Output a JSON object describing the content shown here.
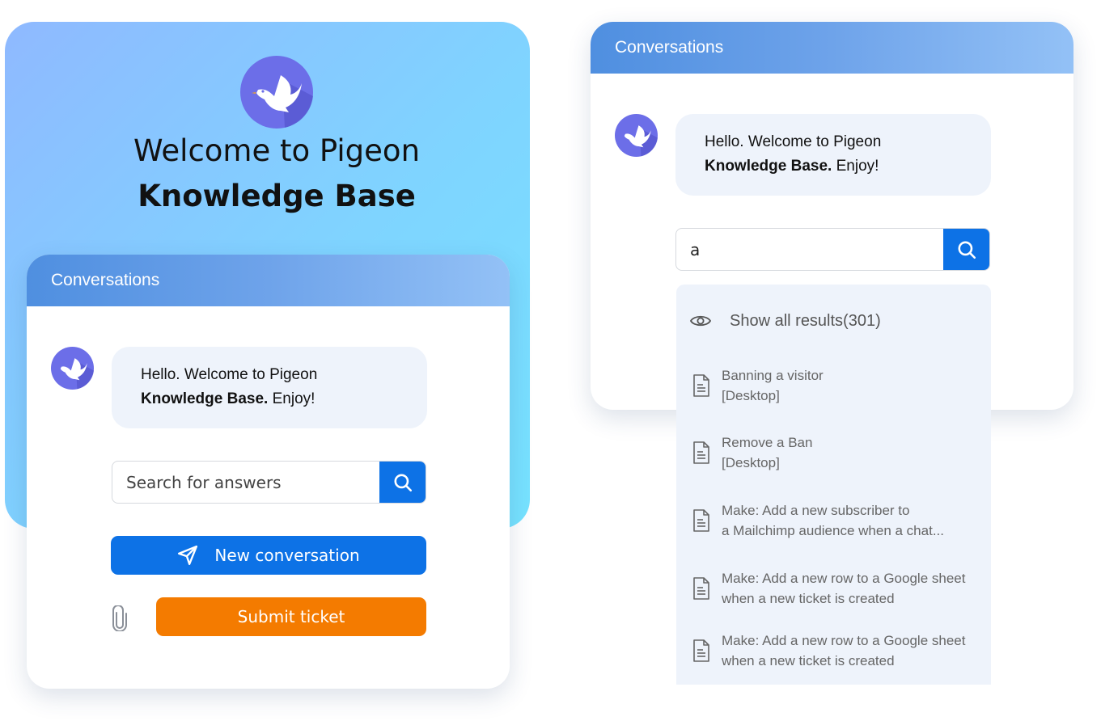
{
  "hero": {
    "title_line1": "Welcome to Pigeon",
    "title_line2": "Knowledge Base",
    "logo_icon": "pigeon-logo-icon"
  },
  "colors": {
    "accent_blue": "#0d72e6",
    "ticket_orange": "#f47b00",
    "avatar_purple": "#6c6ee8",
    "bubble_bg": "#eef3fb"
  },
  "left_widget": {
    "header_title": "Conversations",
    "message": {
      "line1": "Hello. Welcome to Pigeon",
      "bold": "Knowledge Base.",
      "rest": " Enjoy!"
    },
    "search": {
      "placeholder": "Search for answers",
      "value": ""
    },
    "new_conversation_label": "New conversation",
    "submit_ticket_label": "Submit ticket",
    "icons": [
      "search-icon",
      "send-icon",
      "paperclip-icon"
    ]
  },
  "right_widget": {
    "header_title": "Conversations",
    "message": {
      "line1": "Hello. Welcome to Pigeon",
      "bold": "Knowledge Base.",
      "rest": " Enjoy!"
    },
    "search": {
      "value": "a"
    },
    "results": {
      "show_all_label": "Show all results(301)",
      "items": [
        {
          "line1": "Banning a visitor",
          "line2": "[Desktop]"
        },
        {
          "line1": "Remove a Ban",
          "line2": "[Desktop]"
        },
        {
          "line1": "Make: Add a new subscriber to",
          "line2": "a Mailchimp audience when a chat..."
        },
        {
          "line1": "Make: Add a new row to a Google sheet",
          "line2": "when a new ticket is created"
        },
        {
          "line1": "Make: Add a new row to a Google sheet",
          "line2": "when a new ticket is created"
        }
      ]
    }
  }
}
